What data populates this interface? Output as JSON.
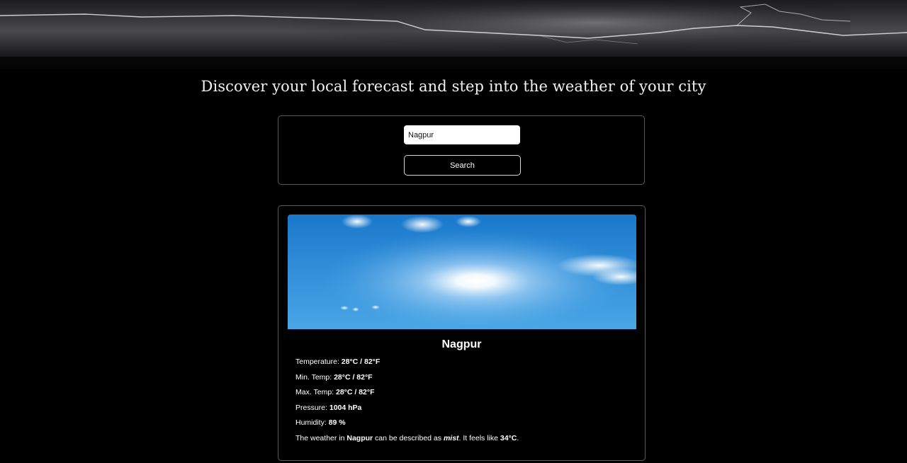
{
  "page": {
    "headline": "Discover your local forecast and step into the weather of your city"
  },
  "search": {
    "value": "Nagpur",
    "placeholder": "",
    "button_label": "Search"
  },
  "result": {
    "city": "Nagpur",
    "temperature_label": "Temperature: ",
    "temperature_value": "28°C / 82°F",
    "min_temp_label": "Min. Temp: ",
    "min_temp_value": "28°C / 82°F",
    "max_temp_label": "Max. Temp: ",
    "max_temp_value": "28°C / 82°F",
    "pressure_label": "Pressure: ",
    "pressure_value": "1004 hPa",
    "humidity_label": "Humidity: ",
    "humidity_value": "89 %",
    "description_prefix": "The weather in ",
    "description_city": "Nagpur",
    "description_middle": " can be described as ",
    "description_condition": "mist",
    "description_feels": ". It feels like ",
    "description_feels_value": "34°C",
    "description_end": "."
  },
  "colors": {
    "background": "#000000",
    "text": "#ffffff",
    "border": "#5a5a5a",
    "sky_top": "#1f7fd0",
    "sky_bottom": "#5bb0ea"
  }
}
